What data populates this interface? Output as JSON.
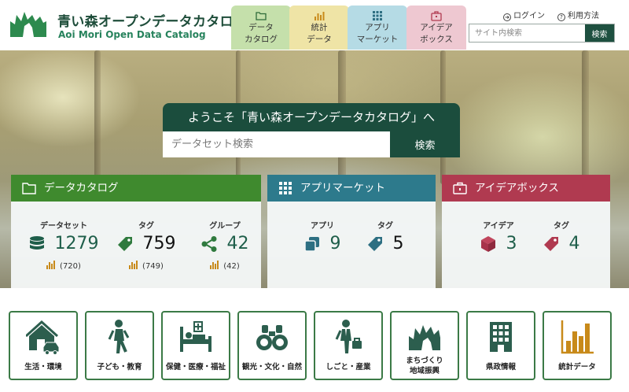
{
  "header": {
    "logo_title": "青い森オープンデータカタログ",
    "logo_subtitle": "Aoi Mori Open Data Catalog",
    "nav_tabs": [
      {
        "line1": "データ",
        "line2": "カタログ",
        "icon": "folder-icon"
      },
      {
        "line1": "統計",
        "line2": "データ",
        "icon": "bar-chart-icon"
      },
      {
        "line1": "アプリ",
        "line2": "マーケット",
        "icon": "grid-icon"
      },
      {
        "line1": "アイデア",
        "line2": "ボックス",
        "icon": "toolbox-icon"
      }
    ],
    "login_label": "ログイン",
    "help_label": "利用方法",
    "search_placeholder": "サイト内検索",
    "search_button": "検索"
  },
  "hero": {
    "welcome": "ようこそ「青い森オープンデータカタログ」へ",
    "search_placeholder": "データセット検索",
    "search_button": "検索"
  },
  "cards": {
    "catalog": {
      "title": "データカタログ",
      "color": "#3f8a2e",
      "stats": [
        {
          "label": "データセット",
          "value": "1279",
          "sub": "(720)",
          "icon": "database-icon"
        },
        {
          "label": "タグ",
          "value": "759",
          "sub": "(749)",
          "icon": "tag-icon"
        },
        {
          "label": "グループ",
          "value": "42",
          "sub": "(42)",
          "icon": "share-icon"
        }
      ]
    },
    "app": {
      "title": "アプリマーケット",
      "color": "#2d7a8c",
      "stats": [
        {
          "label": "アプリ",
          "value": "9",
          "icon": "copy-icon"
        },
        {
          "label": "タグ",
          "value": "5",
          "icon": "tag-icon"
        }
      ]
    },
    "idea": {
      "title": "アイデアボックス",
      "color": "#b03a50",
      "stats": [
        {
          "label": "アイデア",
          "value": "3",
          "icon": "cube-icon"
        },
        {
          "label": "タグ",
          "value": "4",
          "icon": "tag-icon"
        }
      ]
    }
  },
  "categories": [
    {
      "label": "生活・環境",
      "icon": "house-car-icon"
    },
    {
      "label": "子ども・教育",
      "icon": "child-walking-icon"
    },
    {
      "label": "保健・医療・福祉",
      "icon": "hospital-bed-icon"
    },
    {
      "label": "観光・文化・自然",
      "icon": "binoculars-icon"
    },
    {
      "label": "しごと・産業",
      "icon": "businessman-icon"
    },
    {
      "label": "まちづくり",
      "label2": "地域振興",
      "icon": "prefecture-map-icon"
    },
    {
      "label": "県政情報",
      "icon": "building-icon"
    },
    {
      "label": "統計データ",
      "icon": "bar-chart-icon"
    }
  ],
  "colors": {
    "brand_dark": "#1b4d3d",
    "tile_border": "#3b7a46",
    "stat_bar": "#c88a1a"
  }
}
